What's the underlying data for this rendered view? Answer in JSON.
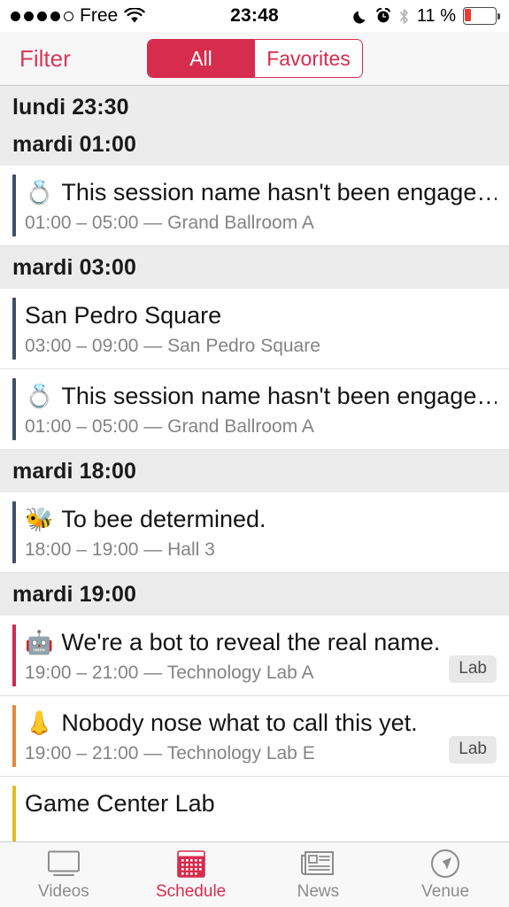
{
  "status_bar": {
    "signal_dots_filled": 4,
    "signal_dots_total": 5,
    "carrier": "Free",
    "wifi_icon": "wifi-icon",
    "time": "23:48",
    "do_not_disturb_icon": "moon-icon",
    "alarm_icon": "alarm-clock-icon",
    "bluetooth_icon": "bluetooth-icon",
    "battery_percent": "11 %",
    "battery_level": 11,
    "battery_icon": "battery-icon",
    "battery_color": "#ec3b32"
  },
  "topbar": {
    "filter_label": "Filter",
    "segments": [
      {
        "label": "All",
        "selected": true
      },
      {
        "label": "Favorites",
        "selected": false
      }
    ],
    "accent_color": "#d62c4e"
  },
  "sections": [
    {
      "header": "lundi 23:30",
      "rows": []
    },
    {
      "header": "mardi 01:00",
      "rows": [
        {
          "emoji": "💍",
          "emoji_name": "ring-emoji",
          "title": "This session name hasn't been engage…",
          "subtitle": "01:00 – 05:00 — Grand Ballroom A",
          "accent": "#3d5068",
          "badge": ""
        }
      ]
    },
    {
      "header": "mardi 03:00",
      "rows": [
        {
          "emoji": "",
          "emoji_name": "",
          "title": "San Pedro Square",
          "subtitle": "03:00 – 09:00 — San Pedro Square",
          "accent": "#3d5068",
          "badge": ""
        },
        {
          "emoji": "💍",
          "emoji_name": "ring-emoji",
          "title": "This session name hasn't been engage…",
          "subtitle": "01:00 – 05:00 — Grand Ballroom A",
          "accent": "#3d5068",
          "badge": ""
        }
      ]
    },
    {
      "header": "mardi 18:00",
      "rows": [
        {
          "emoji": "🐝",
          "emoji_name": "bee-emoji",
          "title": "To bee determined.",
          "subtitle": "18:00 – 19:00 — Hall 3",
          "accent": "#3d5068",
          "badge": ""
        }
      ]
    },
    {
      "header": "mardi 19:00",
      "rows": [
        {
          "emoji": "🤖",
          "emoji_name": "robot-emoji",
          "title": "We're a bot to reveal the real name.",
          "subtitle": "19:00 – 21:00 — Technology Lab A",
          "accent": "#ce2b52",
          "badge": "Lab"
        },
        {
          "emoji": "👃",
          "emoji_name": "nose-emoji",
          "title": "Nobody nose what to call this yet.",
          "subtitle": "19:00 – 21:00 — Technology Lab E",
          "accent": "#e08a3c",
          "badge": "Lab"
        },
        {
          "emoji": "",
          "emoji_name": "",
          "title": "Game Center Lab",
          "subtitle": "",
          "accent": "#e8b91f",
          "badge": "",
          "clipped": true
        }
      ]
    }
  ],
  "tabbar": {
    "tabs": [
      {
        "label": "Videos",
        "icon": "tv-icon",
        "active": false
      },
      {
        "label": "Schedule",
        "icon": "calendar-icon",
        "active": true
      },
      {
        "label": "News",
        "icon": "newspaper-icon",
        "active": false
      },
      {
        "label": "Venue",
        "icon": "compass-icon",
        "active": false
      }
    ],
    "active_color": "#d62c4e",
    "inactive_color": "#8c8c8c"
  }
}
